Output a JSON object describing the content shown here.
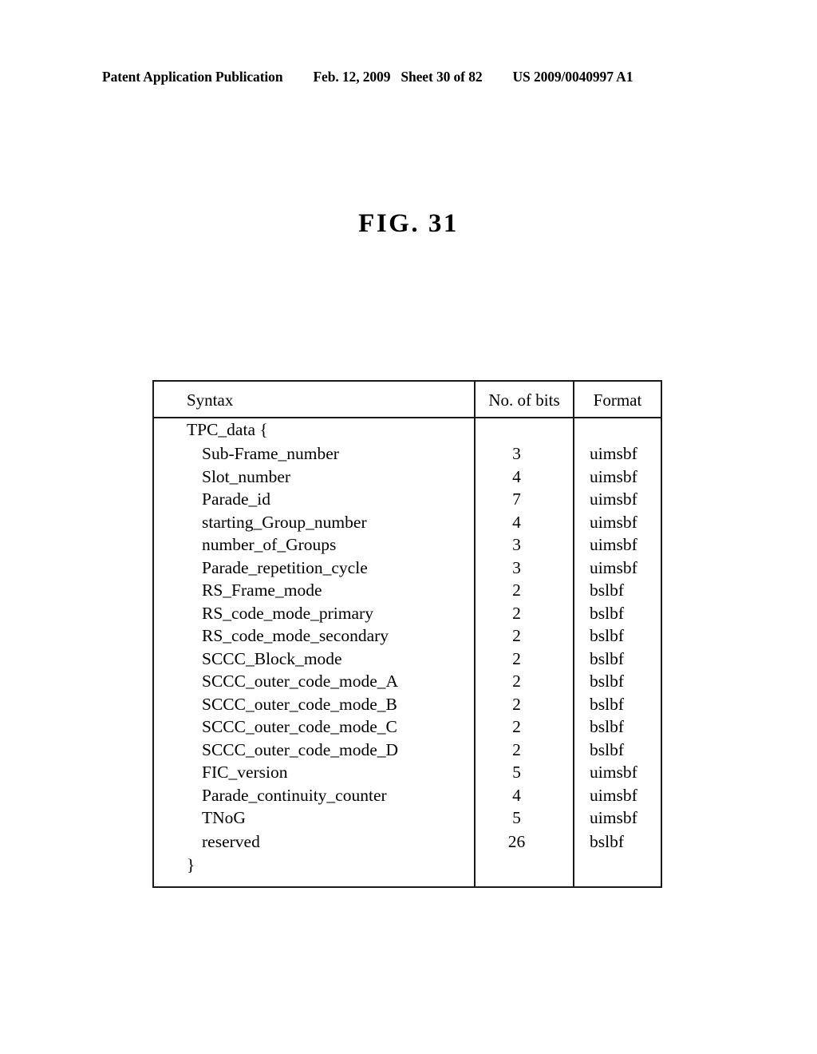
{
  "header": {
    "publication": "Patent Application Publication",
    "date": "Feb. 12, 2009",
    "sheet": "Sheet 30 of 82",
    "patent_number": "US 2009/0040997 A1"
  },
  "figure": {
    "caption": "FIG. 31"
  },
  "table": {
    "columns": [
      "Syntax",
      "No. of bits",
      "Format"
    ],
    "rows": [
      {
        "syntax": "TPC_data {",
        "indent": 0,
        "bits": "",
        "format": ""
      },
      {
        "syntax": "Sub-Frame_number",
        "indent": 1,
        "bits": "3",
        "format": "uimsbf"
      },
      {
        "syntax": "Slot_number",
        "indent": 1,
        "bits": "4",
        "format": "uimsbf"
      },
      {
        "syntax": "Parade_id",
        "indent": 1,
        "bits": "7",
        "format": "uimsbf"
      },
      {
        "syntax": "starting_Group_number",
        "indent": 1,
        "bits": "4",
        "format": "uimsbf"
      },
      {
        "syntax": "number_of_Groups",
        "indent": 1,
        "bits": "3",
        "format": "uimsbf"
      },
      {
        "syntax": "Parade_repetition_cycle",
        "indent": 1,
        "bits": "3",
        "format": "uimsbf"
      },
      {
        "syntax": "RS_Frame_mode",
        "indent": 1,
        "bits": "2",
        "format": "bslbf"
      },
      {
        "syntax": "RS_code_mode_primary",
        "indent": 1,
        "bits": "2",
        "format": "bslbf"
      },
      {
        "syntax": "RS_code_mode_secondary",
        "indent": 1,
        "bits": "2",
        "format": "bslbf"
      },
      {
        "syntax": "SCCC_Block_mode",
        "indent": 1,
        "bits": "2",
        "format": "bslbf"
      },
      {
        "syntax": "SCCC_outer_code_mode_A",
        "indent": 1,
        "bits": "2",
        "format": "bslbf"
      },
      {
        "syntax": "SCCC_outer_code_mode_B",
        "indent": 1,
        "bits": "2",
        "format": "bslbf"
      },
      {
        "syntax": "SCCC_outer_code_mode_C",
        "indent": 1,
        "bits": "2",
        "format": "bslbf"
      },
      {
        "syntax": "SCCC_outer_code_mode_D",
        "indent": 1,
        "bits": "2",
        "format": "bslbf"
      },
      {
        "syntax": "FIC_version",
        "indent": 1,
        "bits": "5",
        "format": "uimsbf"
      },
      {
        "syntax": "Parade_continuity_counter",
        "indent": 1,
        "bits": "4",
        "format": "uimsbf"
      },
      {
        "syntax": "TNoG",
        "indent": 1,
        "bits": "5",
        "format": "uimsbf"
      },
      {
        "syntax": "reserved",
        "indent": 1,
        "bits": "26",
        "format": "bslbf"
      },
      {
        "syntax": "}",
        "indent": 0,
        "bits": "",
        "format": ""
      }
    ]
  }
}
